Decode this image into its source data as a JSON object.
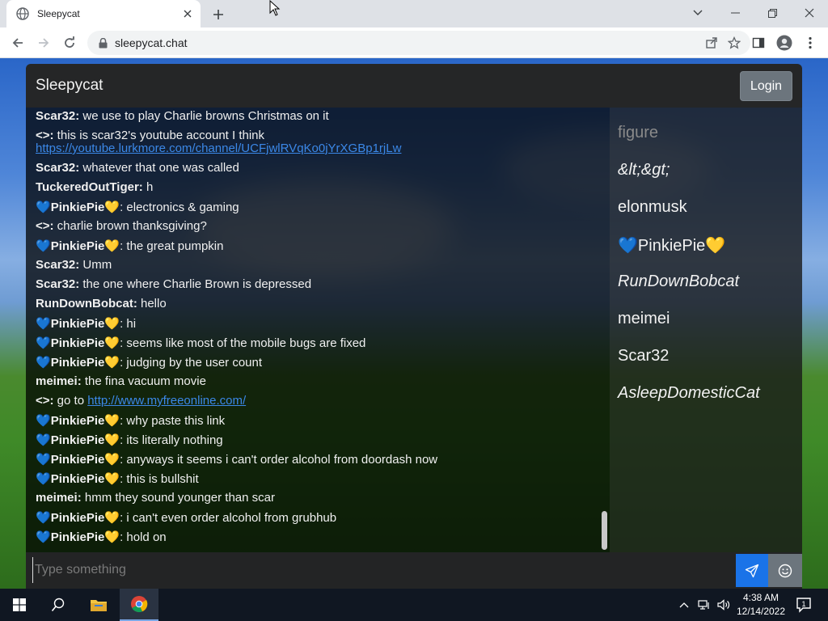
{
  "browser": {
    "tab_title": "Sleepycat",
    "url": "sleepycat.chat"
  },
  "app": {
    "brand": "Sleepycat",
    "login_label": "Login",
    "input_placeholder": "Type something"
  },
  "messages": [
    {
      "author": "Scar32:",
      "text": " we use to play Charlie browns Christmas on it"
    },
    {
      "author": "<>:",
      "text": " this is scar32's youtube account I think"
    },
    {
      "author": "",
      "link": "https://youtube.lurkmore.com/channel/UCFjwlRVqKo0jYrXGBp1rjLw"
    },
    {
      "author": "Scar32:",
      "text": " whatever that one was called"
    },
    {
      "author": "TuckeredOutTiger:",
      "text": " h"
    },
    {
      "author": "PinkiePie",
      "hearts": true,
      "text": ": electronics & gaming"
    },
    {
      "author": "<>:",
      "text": " charlie brown thanksgiving?"
    },
    {
      "author": "PinkiePie",
      "hearts": true,
      "text": ": the great pumpkin"
    },
    {
      "author": "Scar32:",
      "text": " Umm"
    },
    {
      "author": "Scar32:",
      "text": " the one where Charlie Brown is depressed"
    },
    {
      "author": "RunDownBobcat:",
      "text": " hello"
    },
    {
      "author": "PinkiePie",
      "hearts": true,
      "text": ": hi"
    },
    {
      "author": "PinkiePie",
      "hearts": true,
      "text": ": seems like most of the mobile bugs are fixed"
    },
    {
      "author": "PinkiePie",
      "hearts": true,
      "text": ": judging by the user count"
    },
    {
      "author": "meimei:",
      "text": " the fina vacuum movie"
    },
    {
      "author": "<>:",
      "text": " go to ",
      "link": "http://www.myfreeonline.com/"
    },
    {
      "author": "PinkiePie",
      "hearts": true,
      "text": ": why paste this link"
    },
    {
      "author": "PinkiePie",
      "hearts": true,
      "text": ": its literally nothing"
    },
    {
      "author": "PinkiePie",
      "hearts": true,
      "text": ": anyways it seems i can't order alcohol from doordash now"
    },
    {
      "author": "PinkiePie",
      "hearts": true,
      "text": ": this is bullshit"
    },
    {
      "author": "meimei:",
      "text": " hmm they sound younger than scar"
    },
    {
      "author": "PinkiePie",
      "hearts": true,
      "text": ": i can't even order alcohol from grubhub"
    },
    {
      "author": "PinkiePie",
      "hearts": true,
      "text": ": hold on"
    }
  ],
  "users": [
    {
      "name": "figure",
      "style": "dim"
    },
    {
      "name": "&lt;&gt;",
      "style": "ital"
    },
    {
      "name": "elonmusk",
      "style": "normal"
    },
    {
      "name": "PinkiePie",
      "style": "hearts"
    },
    {
      "name": "RunDownBobcat",
      "style": "ital"
    },
    {
      "name": "meimei",
      "style": "normal"
    },
    {
      "name": "Scar32",
      "style": "normal"
    },
    {
      "name": "AsleepDomesticCat",
      "style": "ital"
    }
  ],
  "hearts": {
    "left": "💙",
    "right": "💛"
  },
  "taskbar": {
    "time": "4:38 AM",
    "date": "12/14/2022",
    "notification_count": "1"
  },
  "colors": {
    "accent_send": "#1a73e8",
    "login_bg": "#6c757d",
    "link": "#3b88e8"
  },
  "scroll_position": 0.96
}
